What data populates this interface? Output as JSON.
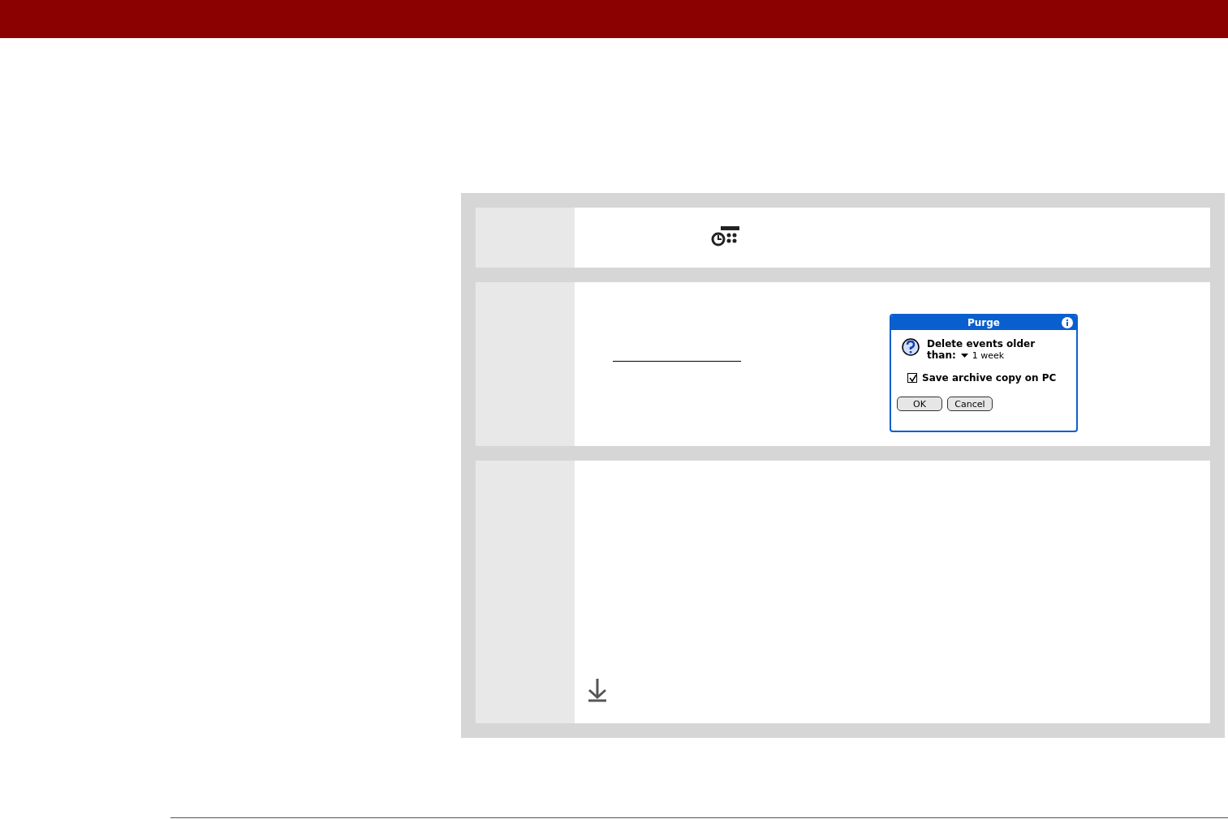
{
  "steps": [
    {
      "kind": "app-icon"
    },
    {
      "kind": "dialog",
      "dialog": {
        "title": "Purge",
        "prompt": "Delete events older",
        "period_label": "than:",
        "period": "1 week",
        "archive": {
          "label": "Save archive copy on PC",
          "checked": true
        },
        "buttons": [
          "OK",
          "Cancel"
        ]
      }
    },
    {
      "kind": "download"
    }
  ]
}
